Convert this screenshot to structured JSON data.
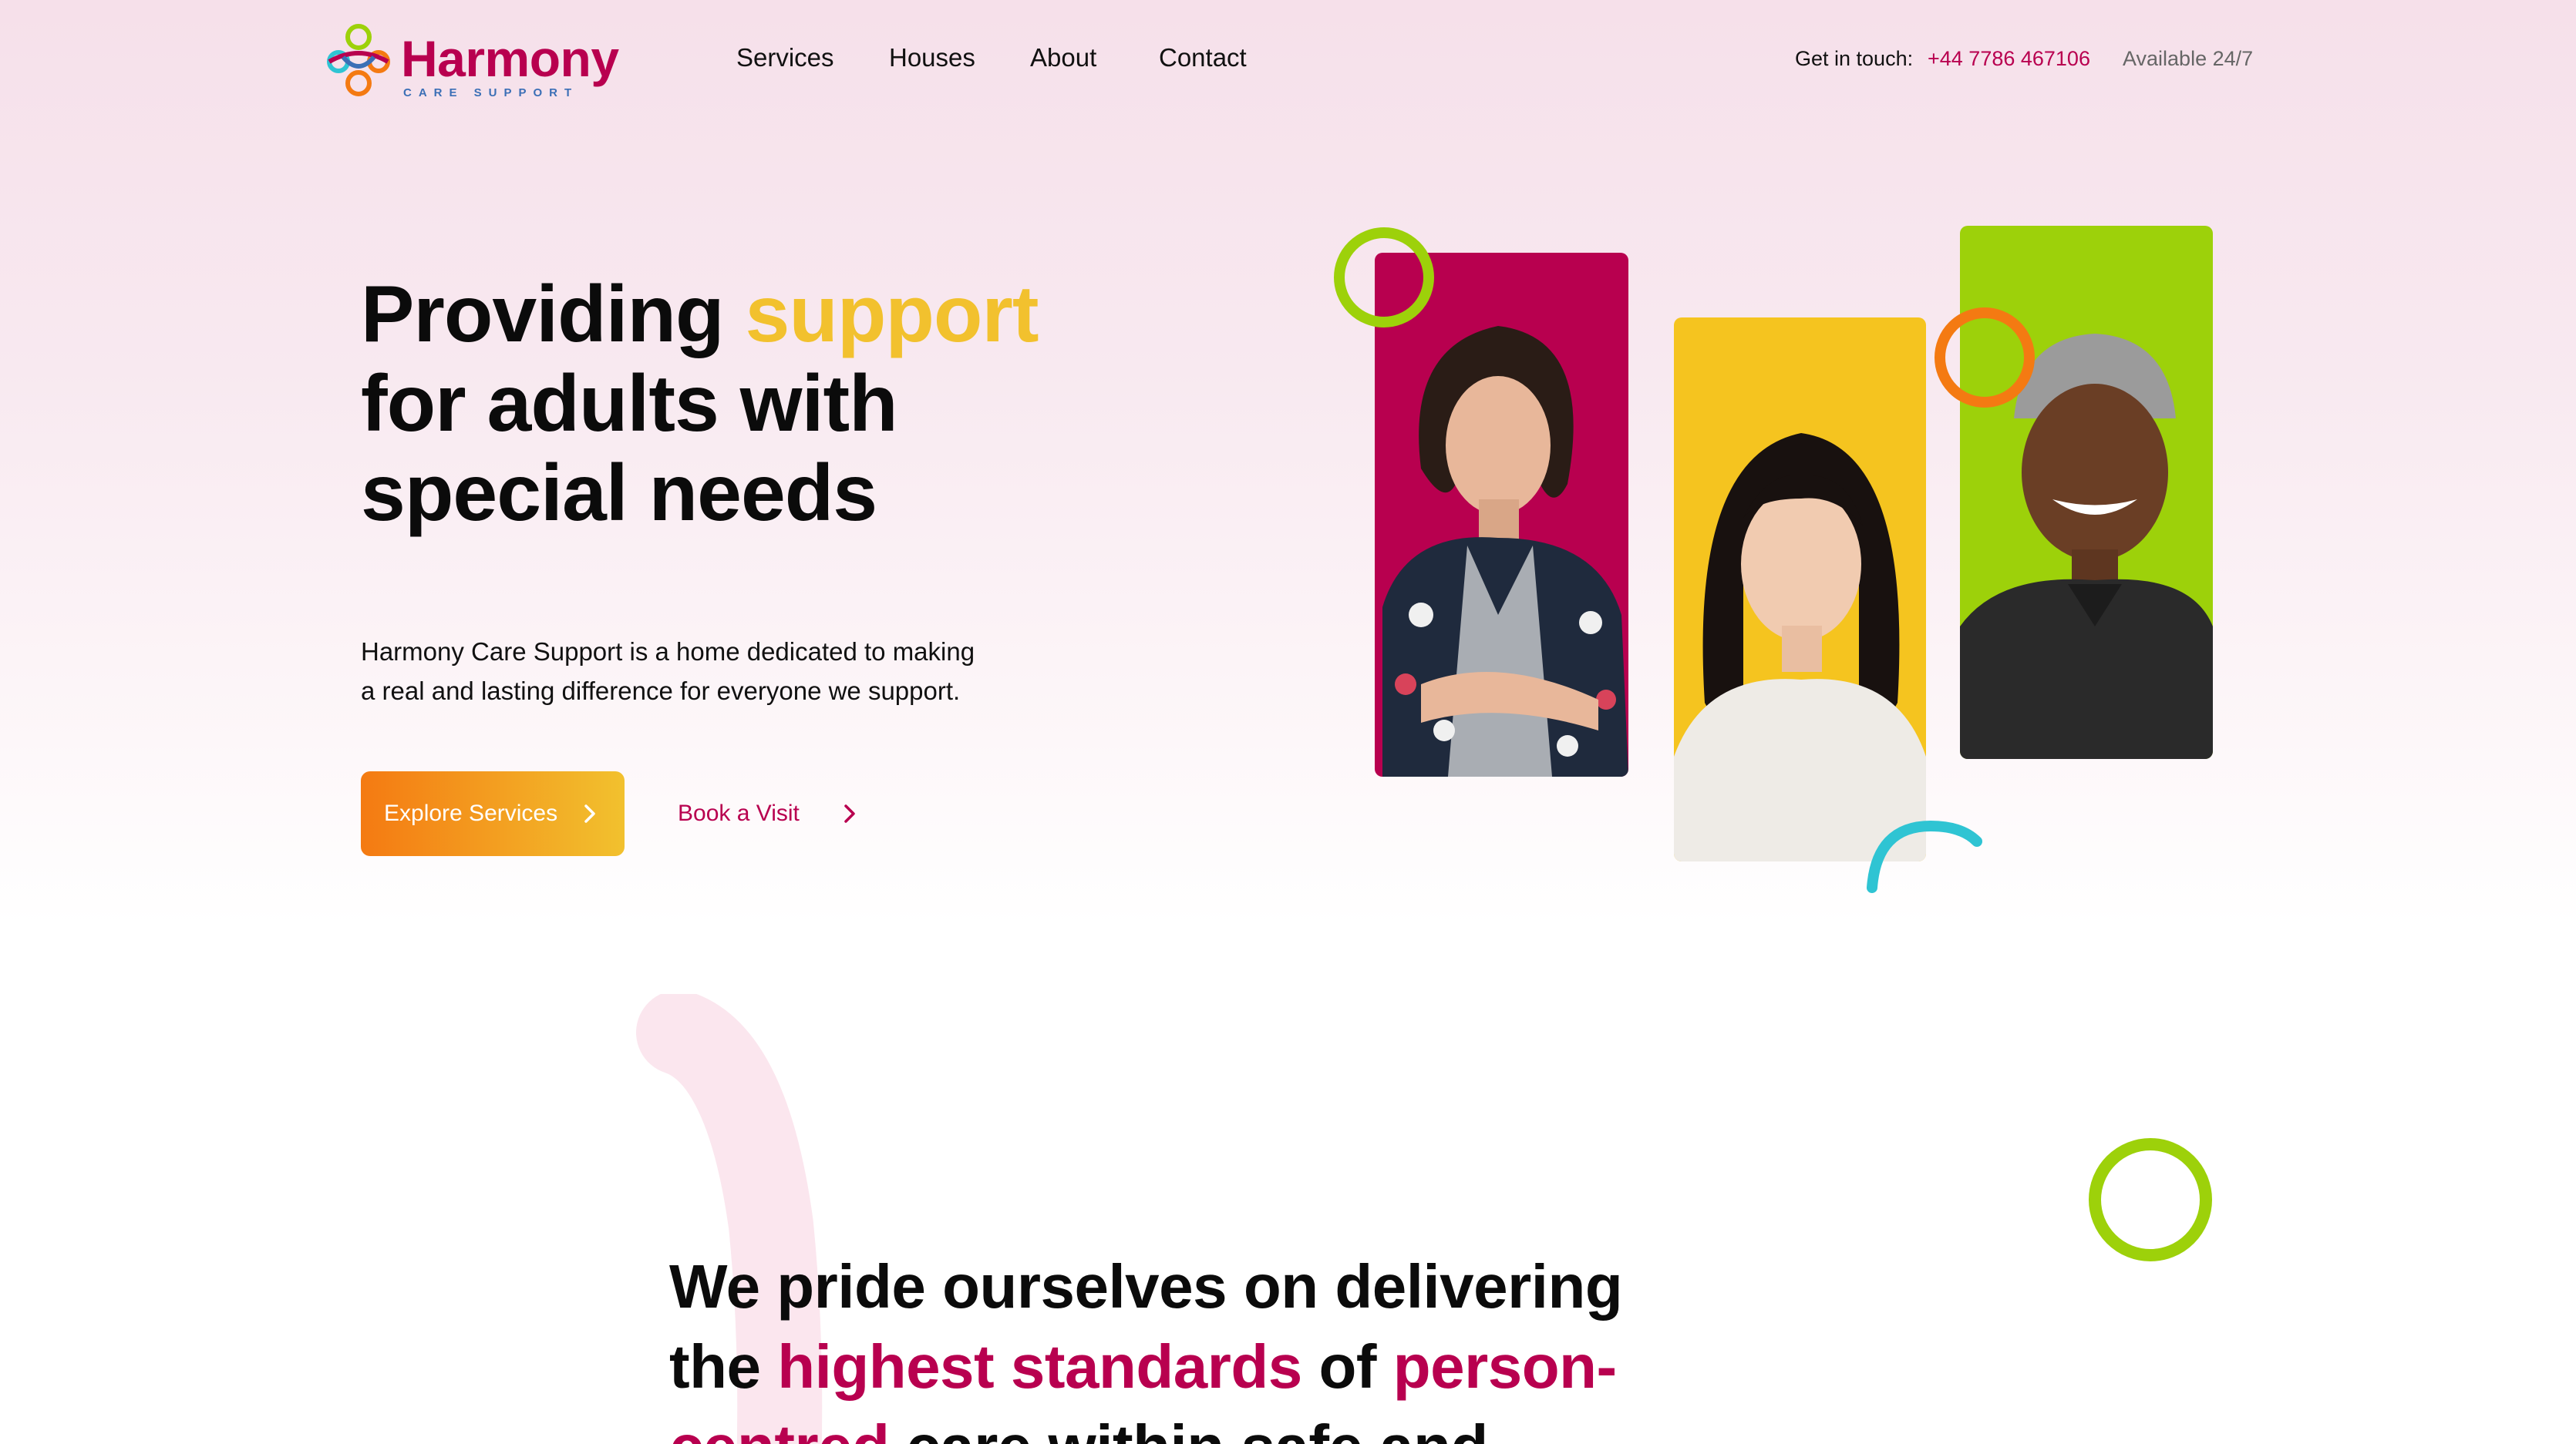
{
  "brand": {
    "name": "Harmony",
    "tagline": "CARE SUPPORT"
  },
  "nav": {
    "items": [
      {
        "label": "Services"
      },
      {
        "label": "Houses"
      },
      {
        "label": "About"
      },
      {
        "label": "Contact"
      }
    ]
  },
  "contact": {
    "label": "Get in touch:",
    "phone": "+44 7786 467106",
    "availability": "Available 24/7"
  },
  "hero": {
    "title_part1": "Providing ",
    "title_accent": "support",
    "title_part2": "for adults with special needs",
    "description": "Harmony Care Support is a home dedicated to making a real and lasting difference for everyone we support.",
    "primary_button": "Explore Services",
    "secondary_button": "Book a Visit"
  },
  "intro": {
    "part1": "We pride ourselves on delivering the ",
    "highlight1": "highest standards",
    "part2": " of ",
    "highlight2": "person-centred",
    "part3": " care within safe and"
  },
  "colors": {
    "brand_primary": "#b8004f",
    "accent_yellow": "#f2c12e",
    "accent_orange": "#f47a12",
    "accent_green": "#9dd10a",
    "accent_teal": "#2fc4d3",
    "photo_bg_magenta": "#b8004f",
    "photo_bg_yellow": "#f5c41f",
    "photo_bg_green": "#9dd10a"
  },
  "icons": {
    "logo": "harmony-logo-icon",
    "chevron": "chevron-right-icon"
  }
}
